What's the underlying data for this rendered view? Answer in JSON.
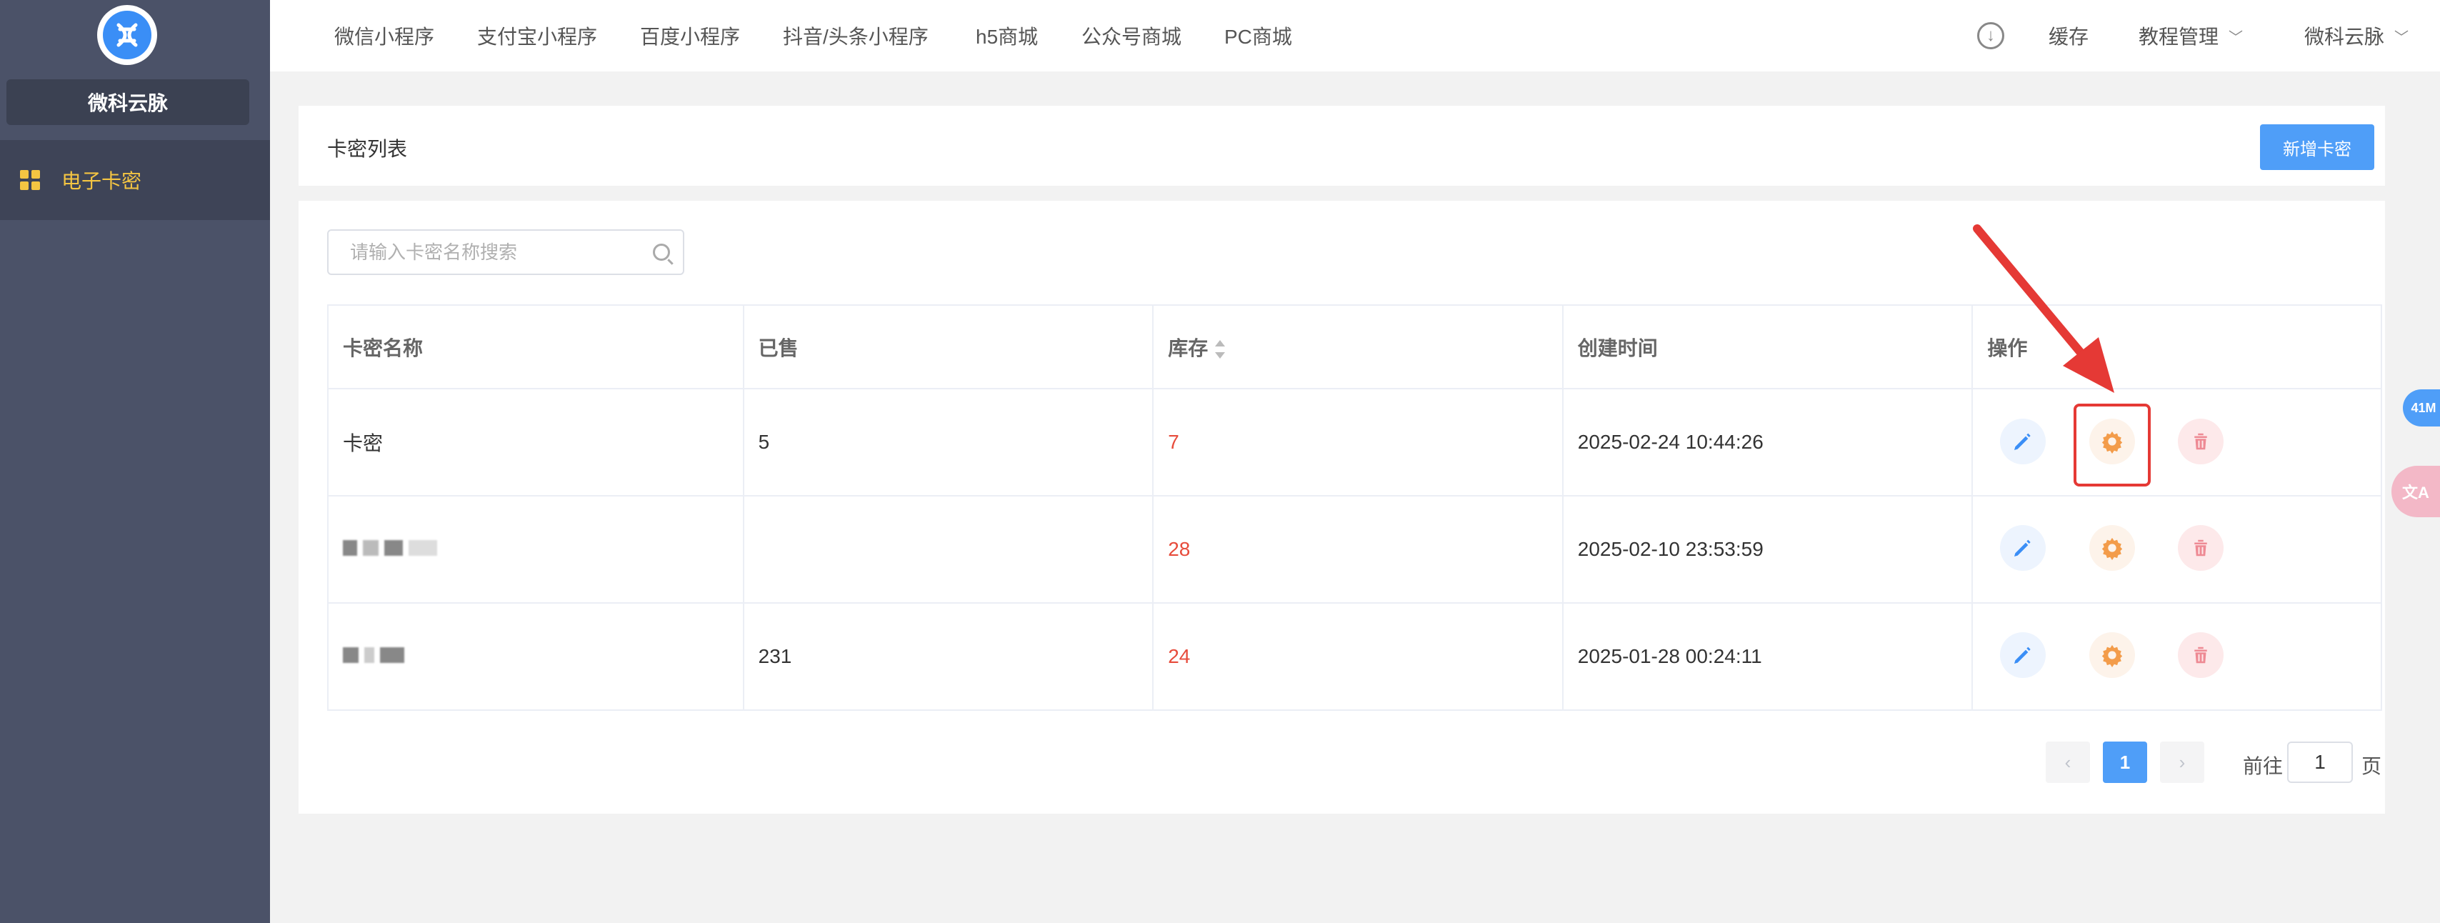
{
  "brand": {
    "name": "微科云脉"
  },
  "sidebar": {
    "items": [
      {
        "label": "电子卡密",
        "icon": "grid-icon",
        "active": true
      }
    ]
  },
  "topnav": {
    "items": [
      "微信小程序",
      "支付宝小程序",
      "百度小程序",
      "抖音/头条小程序",
      "h5商城",
      "公众号商城",
      "PC商城"
    ],
    "right": {
      "cache": "缓存",
      "tutorial": "教程管理",
      "user": "微科云脉"
    }
  },
  "header": {
    "title": "卡密列表",
    "add_button": "新增卡密"
  },
  "search": {
    "placeholder": "请输入卡密名称搜索"
  },
  "table": {
    "columns": [
      "卡密名称",
      "已售",
      "库存",
      "创建时间",
      "操作"
    ],
    "rows": [
      {
        "name": "卡密",
        "sold": "5",
        "stock": "7",
        "created": "2025-02-24 10:44:26"
      },
      {
        "name": "",
        "sold": "",
        "stock": "28",
        "created": "2025-02-10 23:53:59"
      },
      {
        "name": "",
        "sold": "231",
        "stock": "24",
        "created": "2025-01-28 00:24:11"
      }
    ]
  },
  "pagination": {
    "current": "1",
    "goto_label": "前往",
    "page_suffix": "页",
    "goto_value": "1"
  },
  "floating": {
    "badge": "41M",
    "translate": "文A"
  },
  "colors": {
    "accent": "#4f9ef8",
    "sidebar": "#4b5268",
    "highlight": "#e53935",
    "stock": "#e74c3c"
  }
}
